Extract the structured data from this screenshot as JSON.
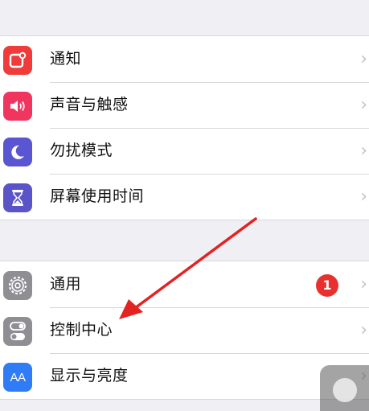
{
  "colors": {
    "background": "#efeff4",
    "notifications_icon": "#f03b3b",
    "sounds_icon": "#f0365f",
    "dnd_icon": "#5a56d2",
    "screentime_icon": "#5a54c8",
    "general_icon": "#8e8e93",
    "control_center_icon": "#8e8e93",
    "display_icon": "#2f7cf6",
    "badge": "#e8302f",
    "arrow": "#e32222"
  },
  "settings": {
    "group1": [
      {
        "label": "通知",
        "icon": "notifications-icon"
      },
      {
        "label": "声音与触感",
        "icon": "sounds-icon"
      },
      {
        "label": "勿扰模式",
        "icon": "moon-icon"
      },
      {
        "label": "屏幕使用时间",
        "icon": "hourglass-icon"
      }
    ],
    "group2": [
      {
        "label": "通用",
        "icon": "gear-icon",
        "badge": "1"
      },
      {
        "label": "控制中心",
        "icon": "toggle-switches-icon"
      },
      {
        "label": "显示与亮度",
        "icon": "text-size-icon",
        "icon_text": "AA"
      }
    ]
  },
  "chevron": "›"
}
